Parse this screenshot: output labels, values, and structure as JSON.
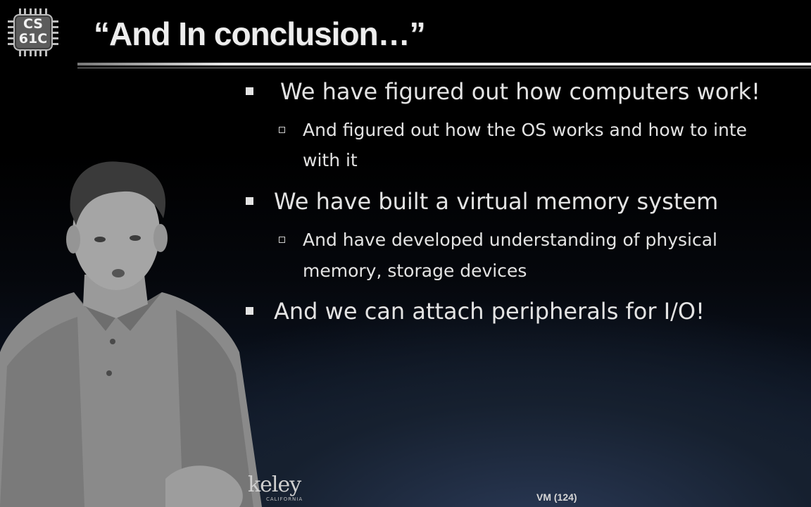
{
  "logo": {
    "line1": "CS",
    "line2": "61C"
  },
  "title": "“And In conclusion…”",
  "bullets": [
    {
      "text": "We have figured out how computers work!",
      "sub": [
        "And figured out how the OS works and how to inte",
        "with it"
      ]
    },
    {
      "text": "We have built a virtual memory system",
      "sub": [
        "And have developed understanding of physical",
        "memory, storage devices"
      ]
    },
    {
      "text": "And we can attach peripherals for I/O!",
      "sub": []
    }
  ],
  "footer": {
    "logo_text": "keley",
    "logo_sub": "CALIFORNIA",
    "page": "VM (124)"
  },
  "colors": {
    "text": "#e3e3e3",
    "background": "#000000",
    "accent_gradient_bottom": "#17233a"
  }
}
